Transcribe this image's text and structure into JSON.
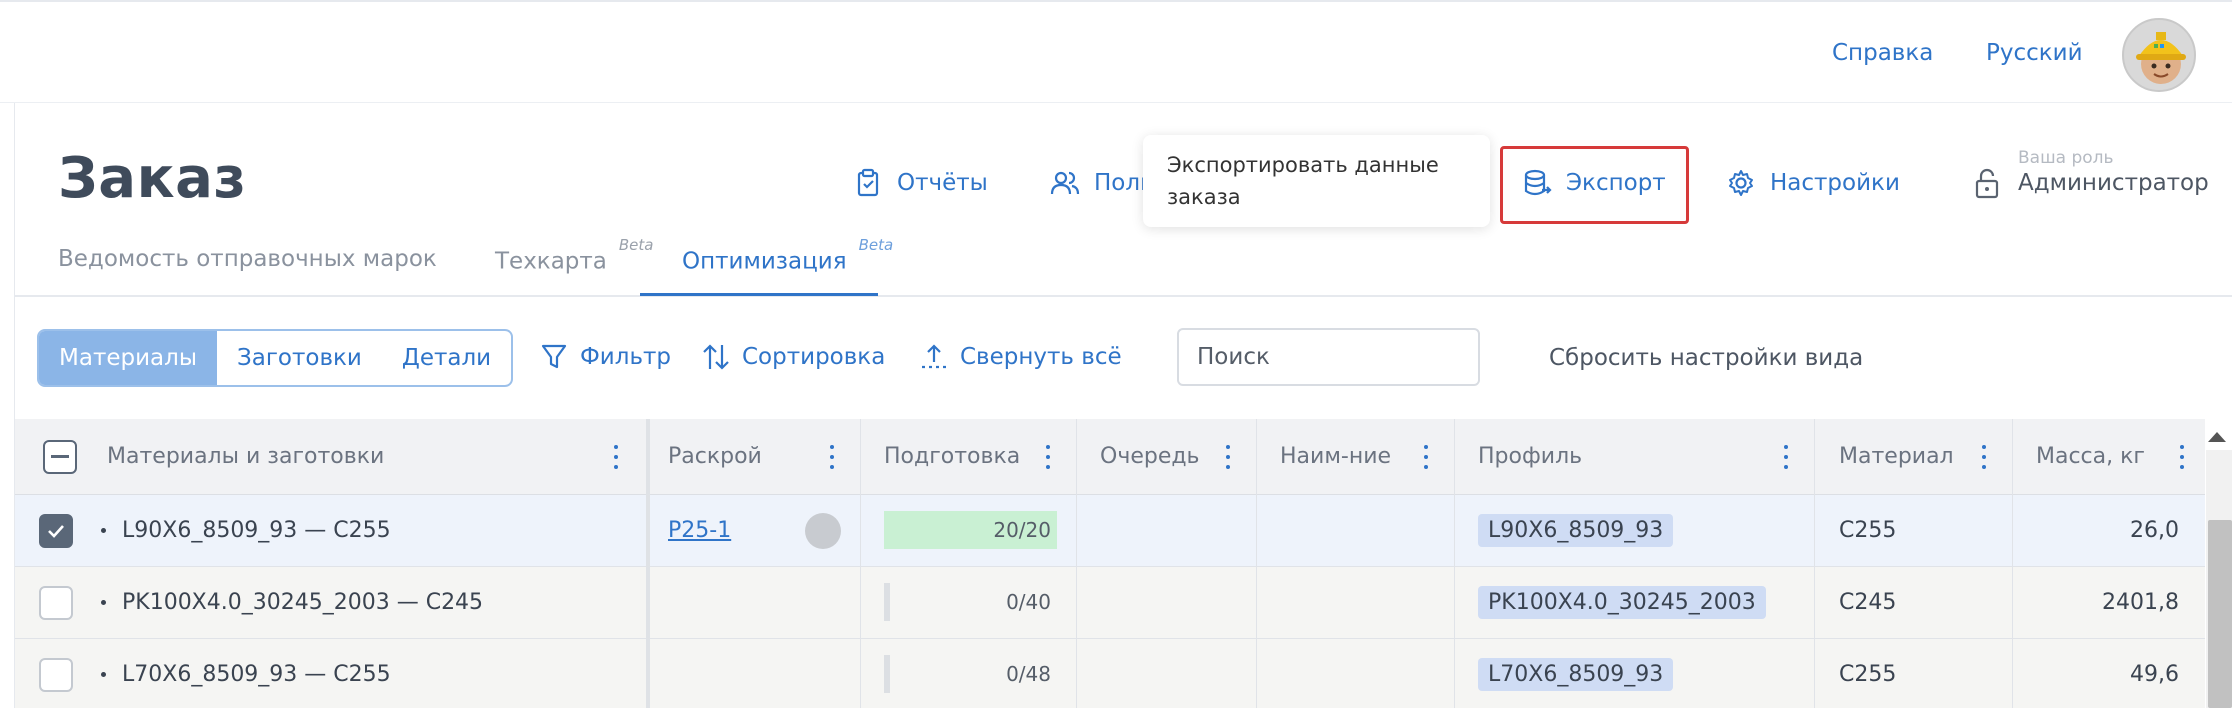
{
  "topbar": {
    "help": "Справка",
    "language": "Русский"
  },
  "page": {
    "title": "Заказ"
  },
  "header_actions": {
    "reports": "Отчёты",
    "users_partial": "Поль",
    "export": "Экспорт",
    "settings": "Настройки",
    "role_label": "Ваша роль",
    "role_value": "Администратор"
  },
  "tooltip": {
    "text": "Экспортировать данные заказа"
  },
  "tabs": [
    {
      "label": "Ведомость отправочных марок",
      "badge": ""
    },
    {
      "label": "Техкарта",
      "badge": "Beta"
    },
    {
      "label": "Оптимизация",
      "badge": "Beta"
    }
  ],
  "segments": [
    "Материалы",
    "Заготовки",
    "Детали"
  ],
  "toolbar": {
    "filter": "Фильтр",
    "sort": "Сортировка",
    "collapse": "Свернуть всё",
    "search_placeholder": "Поиск",
    "reset": "Сбросить настройки вида"
  },
  "table": {
    "columns": [
      "Материалы и заготовки",
      "Раскрой",
      "Подготовка",
      "Очередь",
      "Наим-ние",
      "Профиль",
      "Материал",
      "Масса, кг"
    ],
    "rows": [
      {
        "checked": true,
        "name": "L90X6_8509_93 — C255",
        "cutting": "P25-1",
        "prep": "20/20",
        "prep_fraction": 1.0,
        "queue": "",
        "naming": "",
        "profile": "L90X6_8509_93",
        "material": "C255",
        "mass": "26,0"
      },
      {
        "checked": false,
        "name": "PK100X4.0_30245_2003 — C245",
        "cutting": "",
        "prep": "0/40",
        "prep_fraction": 0.0,
        "queue": "",
        "naming": "",
        "profile": "PK100X4.0_30245_2003",
        "material": "C245",
        "mass": "2401,8"
      },
      {
        "checked": false,
        "name": "L70X6_8509_93 — C255",
        "cutting": "",
        "prep": "0/48",
        "prep_fraction": 0.0,
        "queue": "",
        "naming": "",
        "profile": "L70X6_8509_93",
        "material": "C255",
        "mass": "49,6"
      }
    ]
  },
  "colors": {
    "accent": "#2f74c8",
    "highlight": "#d63a3a",
    "progress_done": "#c9f0d3",
    "tag_bg": "#cfdcf4"
  }
}
